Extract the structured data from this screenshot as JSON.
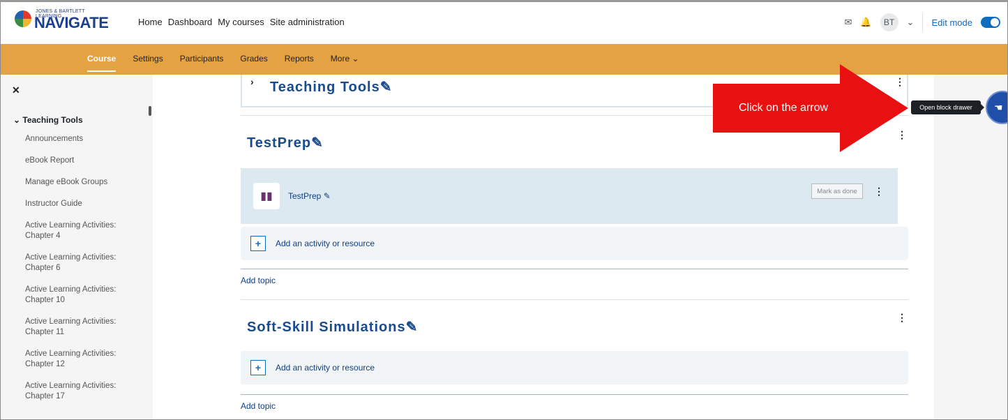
{
  "logo": {
    "small": "JONES & BARTLETT LEARNING",
    "big": "NAVIGATE"
  },
  "topnav": {
    "items": [
      "Home",
      "Dashboard",
      "My courses",
      "Site administration"
    ]
  },
  "user": {
    "initials": "BT",
    "edit_mode": "Edit mode"
  },
  "secnav": {
    "items": [
      "Course",
      "Settings",
      "Participants",
      "Grades",
      "Reports",
      "More ⌄"
    ]
  },
  "drawer": {
    "section": "Teaching Tools",
    "items": [
      "Announcements",
      "eBook Report",
      "Manage eBook Groups",
      "Instructor Guide",
      "Active Learning Activities: Chapter 4",
      "Active Learning Activities: Chapter 6",
      "Active Learning Activities: Chapter 10",
      "Active Learning Activities: Chapter 11",
      "Active Learning Activities: Chapter 12",
      "Active Learning Activities: Chapter 17"
    ]
  },
  "main": {
    "teaching_tools_title": "Teaching Tools",
    "testprep_title": "TestPrep",
    "activity_name": "TestPrep",
    "mark_as_done": "Mark as done",
    "add_activity": "Add an activity or resource",
    "add_topic": "Add topic",
    "softskill_title": "Soft-Skill Simulations"
  },
  "annotation": {
    "text": "Click on the arrow",
    "color": "#e81010"
  },
  "tooltip": "Open block drawer",
  "colors": {
    "accent": "#0f6cbf",
    "secnav": "#e4a242",
    "section_title": "#1a4b8c"
  }
}
